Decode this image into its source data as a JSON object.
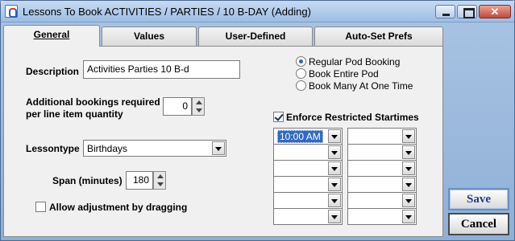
{
  "window": {
    "title": "Lessons To Book  ACTIVITIES / PARTIES / 10 B-DAY (Adding)",
    "close_glyph": "✕"
  },
  "tabs": [
    {
      "label": "General"
    },
    {
      "label": "Values"
    },
    {
      "label": "User-Defined"
    },
    {
      "label": "Auto-Set Prefs"
    }
  ],
  "general": {
    "description_label": "Description",
    "description_value": "Activities Parties 10 B-d",
    "additional_label_1": "Additional bookings required",
    "additional_label_2": "per line item quantity",
    "additional_value": "0",
    "lessontype_label": "Lessontype",
    "lessontype_value": "Birthdays",
    "span_label": "Span (minutes)",
    "span_value": "180",
    "allow_drag_label": "Allow adjustment by dragging",
    "allow_drag_checked": false
  },
  "booking": {
    "options": [
      "Regular Pod Booking",
      "Book Entire Pod",
      "Book Many At One Time"
    ],
    "selected": "Regular Pod Booking"
  },
  "startimes": {
    "enforce_label": "Enforce Restricted Startimes",
    "enforce_checked": true,
    "left": [
      "10:00 AM",
      "",
      "",
      "",
      "",
      ""
    ],
    "right": [
      "",
      "",
      "",
      "",
      "",
      ""
    ]
  },
  "buttons": {
    "save": "Save",
    "cancel": "Cancel"
  }
}
